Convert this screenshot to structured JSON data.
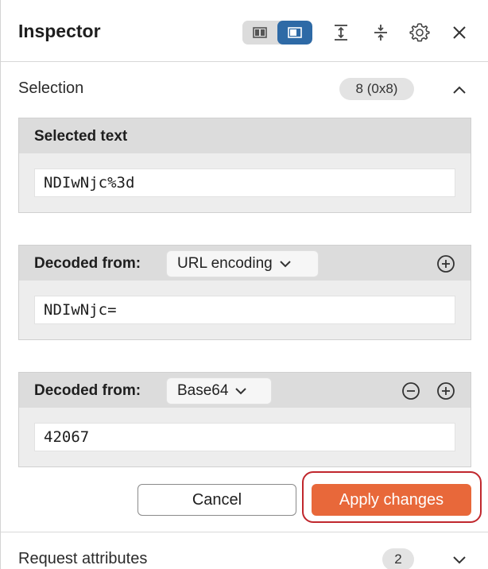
{
  "header": {
    "title": "Inspector",
    "icons": [
      "layout-horizontal-icon",
      "layout-vertical-icon",
      "expand-all-icon",
      "collapse-all-icon",
      "gear-icon",
      "close-icon"
    ]
  },
  "selection": {
    "label": "Selection",
    "badge": "8 (0x8)"
  },
  "selected_text": {
    "title": "Selected text",
    "value": "NDIwNjc%3d"
  },
  "decode1": {
    "title": "Decoded from:",
    "encoding": "URL encoding",
    "value": "NDIwNjc="
  },
  "decode2": {
    "title": "Decoded from:",
    "encoding": "Base64",
    "value": "42067"
  },
  "actions": {
    "cancel_label": "Cancel",
    "apply_label": "Apply changes"
  },
  "request_attributes": {
    "label": "Request attributes",
    "count": "2"
  },
  "colors": {
    "accent": "#e8683a",
    "toggle_active": "#2e6aa6",
    "highlight": "#c0272d"
  }
}
